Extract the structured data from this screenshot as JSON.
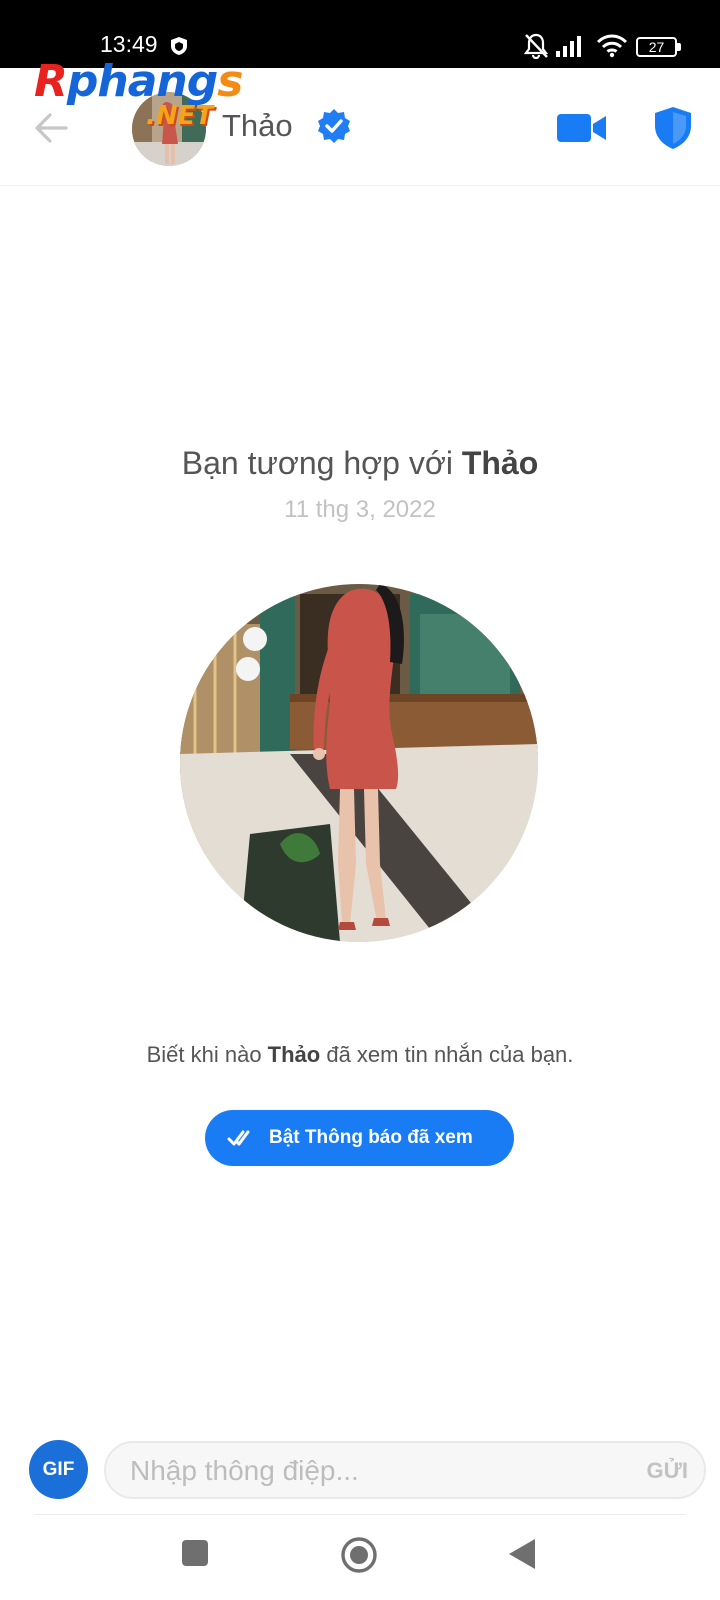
{
  "status_bar": {
    "time": "13:49",
    "battery": "27",
    "icons": [
      "vpn-shield-icon",
      "bell-off-icon",
      "signal-icon",
      "wifi-icon",
      "battery-icon"
    ]
  },
  "watermark": {
    "brand_part1": "R",
    "brand_part2": "phang",
    "brand_part3": "s",
    "brand_suffix": ".NET"
  },
  "header": {
    "name": "Thảo",
    "icons": [
      "back-arrow-icon",
      "verified-icon",
      "video-camera-icon",
      "shield-icon"
    ]
  },
  "match": {
    "prefix": "Bạn tương hợp với ",
    "name": "Thảo",
    "date": "11 thg 3, 2022"
  },
  "read_receipts": {
    "prefix": "Biết khi nào ",
    "name": "Thảo",
    "suffix": " đã xem tin nhắn của bạn.",
    "button_label": "Bật Thông báo đã xem"
  },
  "composer": {
    "gif_label": "GIF",
    "placeholder": "Nhập thông điệp...",
    "value": "",
    "send_label": "GỬI"
  },
  "nav": {
    "icons": [
      "recents-square-icon",
      "home-circle-icon",
      "back-triangle-icon"
    ]
  },
  "colors": {
    "accent": "#1a7cf5",
    "status_bar_bg": "#000000",
    "gif_bg": "#1a6fd8",
    "muted_text": "#c2c2c2"
  }
}
